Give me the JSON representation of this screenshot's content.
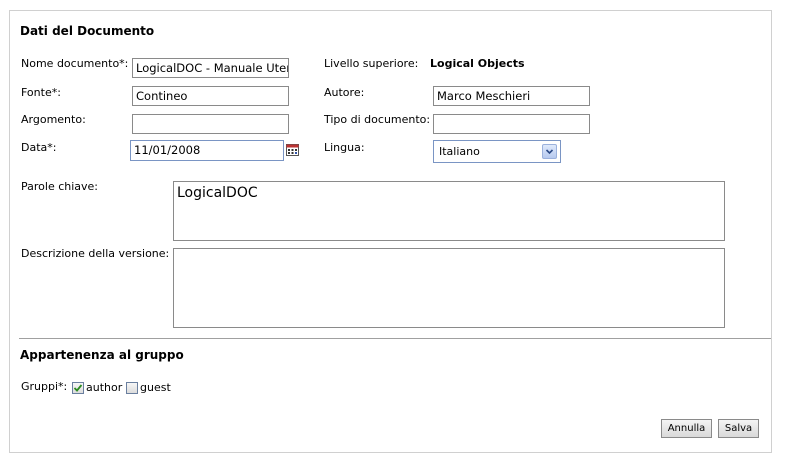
{
  "document_section": {
    "title": "Dati del Documento",
    "name": {
      "label": "Nome documento*:",
      "value": "LogicalDOC - Manuale Utente"
    },
    "parent": {
      "label": "Livello superiore:",
      "value": "Logical Objects"
    },
    "source": {
      "label": "Fonte*:",
      "value": "Contineo"
    },
    "author": {
      "label": "Autore:",
      "value": "Marco Meschieri"
    },
    "subject": {
      "label": "Argomento:",
      "value": ""
    },
    "doc_type": {
      "label": "Tipo di documento:",
      "value": ""
    },
    "date": {
      "label": "Data*:",
      "value": "11/01/2008"
    },
    "language": {
      "label": "Lingua:",
      "value": "Italiano"
    },
    "keywords": {
      "label": "Parole chiave:",
      "value": "LogicalDOC"
    },
    "version_description": {
      "label": "Descrizione della versione:",
      "value": ""
    }
  },
  "group_section": {
    "title": "Appartenenza al gruppo",
    "label": "Gruppi*:",
    "groups": [
      {
        "name": "author",
        "checked": true
      },
      {
        "name": "guest",
        "checked": false
      }
    ]
  },
  "actions": {
    "cancel_label": "Annulla",
    "save_label": "Salva"
  },
  "icons": {
    "calendar": "calendar-icon",
    "dropdown": "chevron-down-icon",
    "check": "checkmark-icon"
  },
  "colors": {
    "focus_border": "#7a95c4",
    "checkmark": "#2a8a1e"
  }
}
